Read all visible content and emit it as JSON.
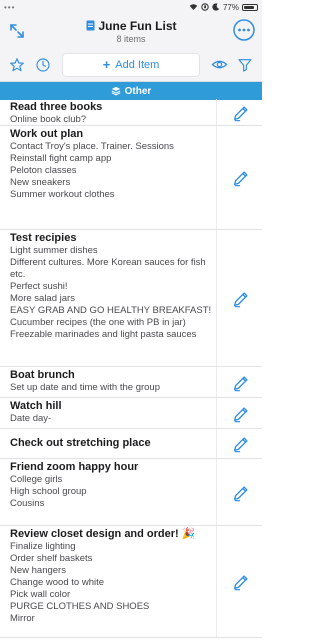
{
  "status": {
    "battery": "77%"
  },
  "header": {
    "title": "June Fun List",
    "subtitle": "8 items"
  },
  "toolbar": {
    "add_label": "Add Item"
  },
  "section": {
    "label": "Other"
  },
  "colors": {
    "accent": "#2f8ee0",
    "section_bar": "#2f9bd8"
  },
  "items": [
    {
      "title": "Read three books",
      "notes": "Online book club?"
    },
    {
      "title": "Work out plan",
      "notes": "Contact Troy's place. Trainer.  Sessions\nReinstall fight camp app\nPeloton classes\nNew sneakers\nSummer workout clothes"
    },
    {
      "title": "Test recipies",
      "notes": "Light summer dishes\nDifferent cultures. More Korean sauces for fish etc.\nPerfect sushi!\nMore salad jars\nEASY GRAB AND GO HEALTHY BREAKFAST!\nCucumber recipes (the one with PB in jar)\nFreezable marinades and light pasta sauces"
    },
    {
      "title": "Boat brunch",
      "notes": "Set up date and time with the group"
    },
    {
      "title": "Watch hill",
      "notes": "Date day-"
    },
    {
      "title": "Check out stretching place",
      "notes": ""
    },
    {
      "title": "Friend zoom happy hour",
      "notes": "College girls\nHigh school group\nCousins"
    },
    {
      "title": "Review closet design and order! 🎉",
      "notes": "Finalize lighting\nOrder shelf baskets\nNew hangers\nChange wood to white\nPick wall color\nPURGE CLOTHES AND SHOES\nMirror"
    }
  ]
}
